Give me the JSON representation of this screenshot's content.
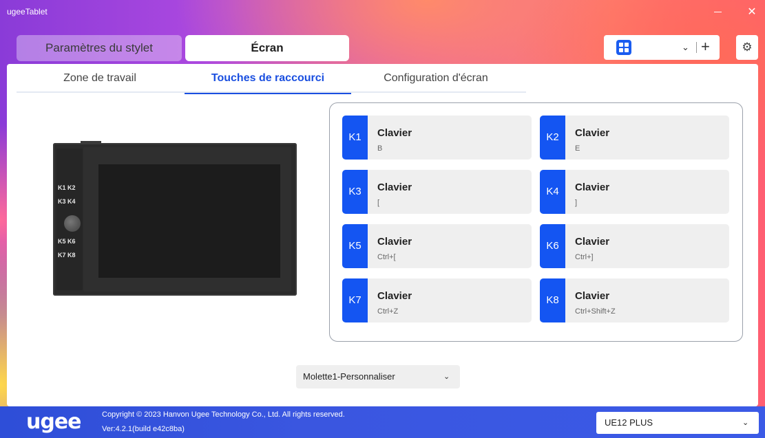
{
  "window": {
    "title": "ugeeTablet",
    "minimize_label": "",
    "close_label": "✕"
  },
  "modes": [
    {
      "label": "Paramètres du stylet",
      "active": false
    },
    {
      "label": "Écran",
      "active": true
    }
  ],
  "toolbar": {
    "plus_label": "+",
    "chevron": "⌄",
    "settings_icon": "gear-icon"
  },
  "subtabs": [
    {
      "label": "Zone de travail",
      "active": false
    },
    {
      "label": "Touches de raccourci",
      "active": true
    },
    {
      "label": "Configuration d'écran",
      "active": false
    }
  ],
  "tablet_keys": [
    "K1 K2",
    "K3 K4",
    "K5 K6",
    "K7 K8"
  ],
  "shortcuts": [
    {
      "id": "K1",
      "name": "Clavier",
      "value": "B"
    },
    {
      "id": "K2",
      "name": "Clavier",
      "value": "E"
    },
    {
      "id": "K3",
      "name": "Clavier",
      "value": "["
    },
    {
      "id": "K4",
      "name": "Clavier",
      "value": "]"
    },
    {
      "id": "K5",
      "name": "Clavier",
      "value": "Ctrl+["
    },
    {
      "id": "K6",
      "name": "Clavier",
      "value": "Ctrl+]"
    },
    {
      "id": "K7",
      "name": "Clavier",
      "value": "Ctrl+Z"
    },
    {
      "id": "K8",
      "name": "Clavier",
      "value": "Ctrl+Shift+Z"
    }
  ],
  "wheel_select": {
    "value": "Molette1-Personnaliser",
    "chevron": "⌄"
  },
  "footer": {
    "logo": "ugee",
    "copyright": "Copyright © 2023 Hanvon Ugee Technology Co., Ltd. All rights reserved.",
    "version": "Ver:4.2.1(build e42c8ba)",
    "device": "UE12 PLUS",
    "chevron": "⌄"
  },
  "colors": {
    "accent": "#1455f2",
    "footer": "#3a56e0"
  }
}
